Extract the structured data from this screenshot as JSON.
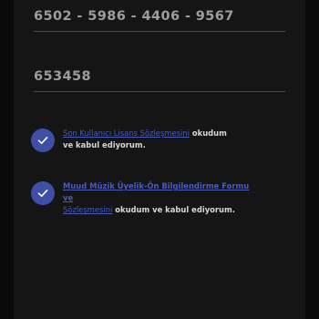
{
  "form": {
    "card_number": "6502 - 5986 - 4406 - 9567",
    "verification_code": "653458"
  },
  "agreements": [
    {
      "link_text": "Son Kullanıcı Lisans Sözleşmesini",
      "line1_suffix": " okudum",
      "line2_text": "ve kabul ediyorum.",
      "checked": true
    },
    {
      "link_text_line1": "Muud Müzik Üyelik-Ön Bilgilendirme Formu ve",
      "link_text_line2": "Sözleşmesini",
      "suffix": " okudum ve kabul ediyorum.",
      "checked": true
    }
  ],
  "colors": {
    "accent": "#3f4fa6",
    "link": "#4a5bb8",
    "background": "#151515"
  },
  "icons": [
    "check-icon"
  ]
}
